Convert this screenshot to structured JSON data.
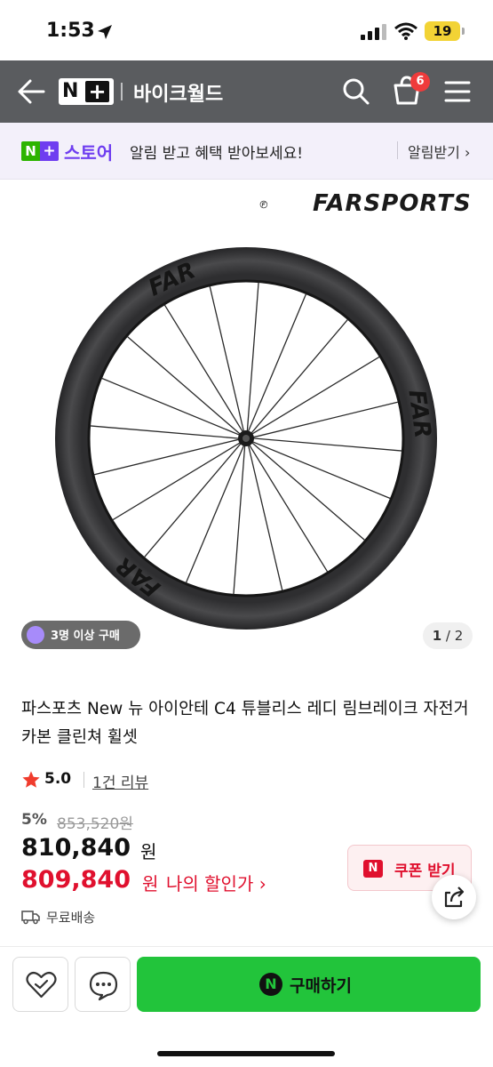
{
  "status_bar": {
    "time": "1:53",
    "battery": "19"
  },
  "header": {
    "store_name": "바이크월드",
    "nplus_n": "N",
    "nplus_plus": "+",
    "cart_count": "6"
  },
  "notice": {
    "logo_n": "N",
    "logo_plus": "+",
    "store_label": "스토어",
    "message": "알림 받고 혜택 받아보세요!",
    "button": "알림받기 ›"
  },
  "gallery": {
    "brand": "FARSPORTS",
    "buyers_badge": "3명 이상 구매",
    "page_current": "1",
    "page_total": "/ 2"
  },
  "product": {
    "name": "파스포츠 New 뉴 아이안테 C4 튜블리스 레디 림브레이크 자전거 카본 클린쳐 휠셋",
    "rating": "5.0",
    "reviews": "1건 리뷰",
    "discount": "5%",
    "original_price": "853,520원",
    "price": "810,840",
    "price_unit": "원",
    "member_price": "809,840",
    "member_unit": "원",
    "member_label": "나의 할인가 ›",
    "coupon_icon": "N",
    "coupon_label": "쿠폰 받기",
    "shipping": "무료배송"
  },
  "bottom": {
    "buy_icon": "N",
    "buy_label": "구매하기"
  },
  "colors": {
    "header_bg": "#5a5c5f",
    "accent_purple": "#6f3ef0",
    "naver_green": "#22c43b",
    "price_red": "#e0102e"
  },
  "icons": [
    "back-arrow-icon",
    "search-icon",
    "cart-icon",
    "menu-icon",
    "wish-heart-icon",
    "talk-chat-icon",
    "share-icon",
    "delivery-truck-icon",
    "star-icon"
  ]
}
